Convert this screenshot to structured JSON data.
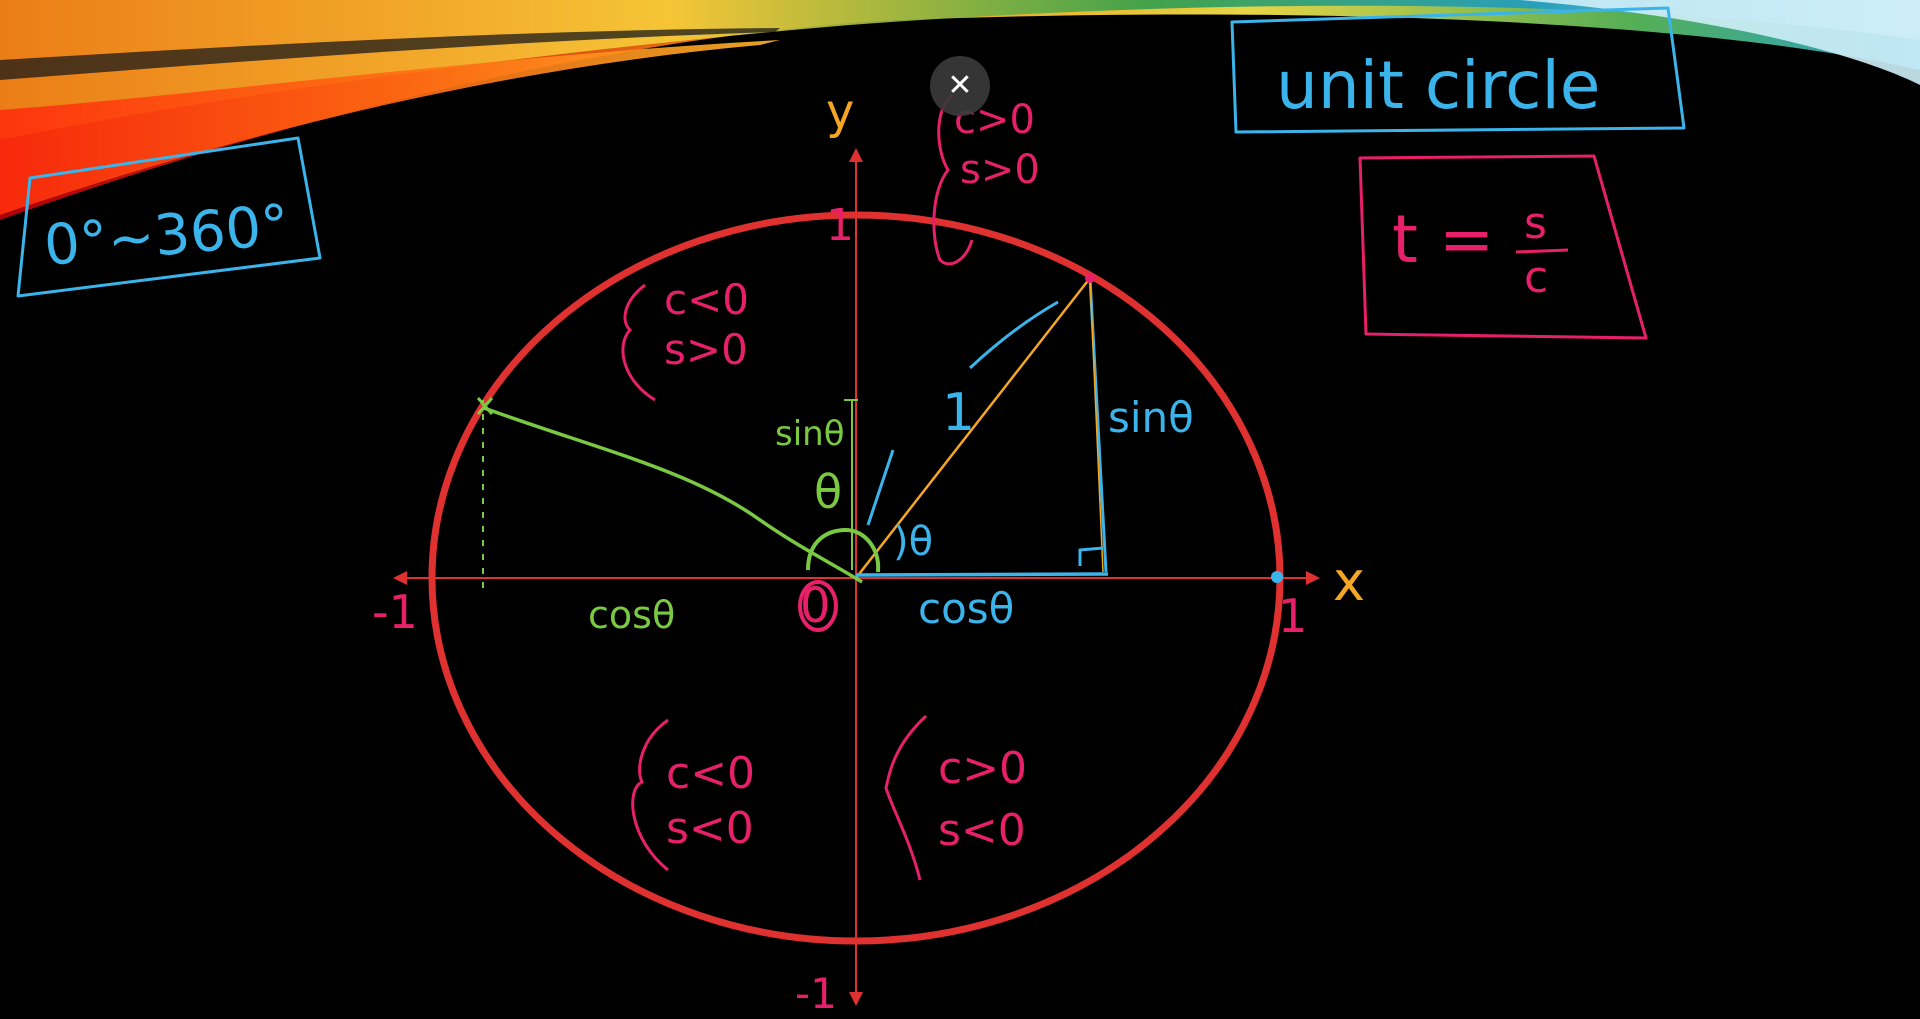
{
  "close_button": {
    "glyph": "✕",
    "icon": "close-icon"
  },
  "colors": {
    "background": "#000000",
    "circle": "#e03131",
    "axis": "#e03131",
    "axis_label": "#f5a623",
    "cyan": "#3ab4ea",
    "pink": "#e8206a",
    "green": "#7ac943",
    "orange": "#f5a623"
  },
  "boxes": {
    "range": {
      "text": "0°~360°"
    },
    "title": {
      "text": "unit circle"
    },
    "formula": {
      "numerator": "s",
      "lhs": "t =",
      "denominator": "c"
    }
  },
  "axes": {
    "x_label": "x",
    "y_label": "y",
    "origin": "0",
    "tick_pos_x": "1",
    "tick_neg_x": "-1",
    "tick_pos_y": "1",
    "tick_neg_y": "-1"
  },
  "quadrants": {
    "q1": [
      "c>0",
      "s>0"
    ],
    "q2": [
      "c<0",
      "s>0"
    ],
    "q3": [
      "c<0",
      "s<0"
    ],
    "q4": [
      "c>0",
      "s<0"
    ]
  },
  "annotations": {
    "radius_label": "1",
    "sin_right": "sinθ",
    "cos_right": "cosθ",
    "theta_blue": ")θ",
    "sin_left": "sinθ",
    "cos_left": "cosθ",
    "theta_green": "θ"
  }
}
